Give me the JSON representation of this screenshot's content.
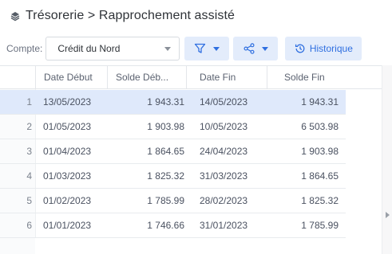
{
  "header": {
    "title": "Trésorerie > Rapprochement assisté"
  },
  "toolbar": {
    "compte_label": "Compte:",
    "compte_value": "Crédit du Nord",
    "historique_label": "Historique"
  },
  "colors": {
    "accent": "#2f6fe0",
    "button_bg": "#e3ecfb",
    "selected_row": "#dfe9fb"
  },
  "grid": {
    "columns": [
      "Date Début",
      "Solde Déb...",
      "Date Fin",
      "Solde Fin"
    ],
    "rows": [
      {
        "num": "1",
        "date_debut": "13/05/2023",
        "solde_debut": "1 943.31",
        "date_fin": "14/05/2023",
        "solde_fin": "1 943.31",
        "selected": true
      },
      {
        "num": "2",
        "date_debut": "01/05/2023",
        "solde_debut": "1 903.98",
        "date_fin": "10/05/2023",
        "solde_fin": "6 503.98",
        "selected": false
      },
      {
        "num": "3",
        "date_debut": "01/04/2023",
        "solde_debut": "1 864.65",
        "date_fin": "24/04/2023",
        "solde_fin": "1 903.98",
        "selected": false
      },
      {
        "num": "4",
        "date_debut": "01/03/2023",
        "solde_debut": "1 825.32",
        "date_fin": "31/03/2023",
        "solde_fin": "1 864.65",
        "selected": false
      },
      {
        "num": "5",
        "date_debut": "01/02/2023",
        "solde_debut": "1 785.99",
        "date_fin": "28/02/2023",
        "solde_fin": "1 825.32",
        "selected": false
      },
      {
        "num": "6",
        "date_debut": "01/01/2023",
        "solde_debut": "1 746.66",
        "date_fin": "31/01/2023",
        "solde_fin": "1 785.99",
        "selected": false
      }
    ]
  }
}
